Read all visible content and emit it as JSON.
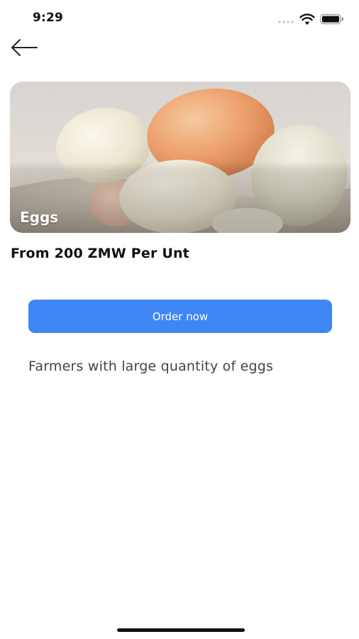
{
  "status_bar": {
    "time": "9:29"
  },
  "header": {
    "back_icon": "arrow-left-icon"
  },
  "product": {
    "title": "Eggs",
    "price": "From 200 ZMW Per Unt",
    "description": "Farmers with large quantity of eggs"
  },
  "actions": {
    "order_label": "Order now"
  },
  "colors": {
    "accent": "#3f87f5",
    "text": "#111111",
    "muted_text": "#444444"
  }
}
